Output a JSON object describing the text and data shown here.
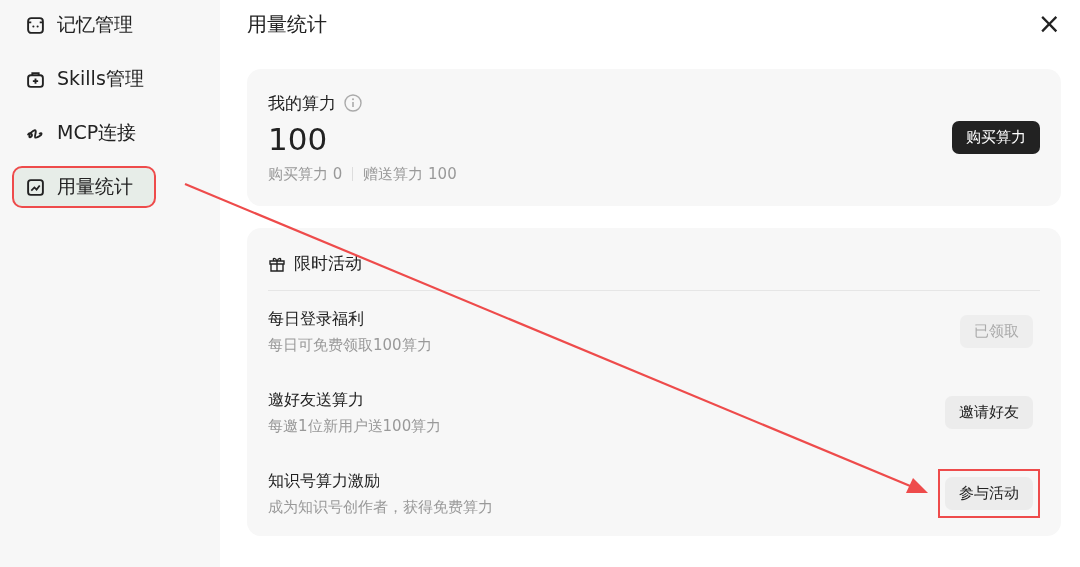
{
  "sidebar": {
    "items": [
      {
        "label": "记忆管理",
        "selected": false,
        "highlighted": false
      },
      {
        "label": "Skills管理",
        "selected": false,
        "highlighted": false
      },
      {
        "label": "MCP连接",
        "selected": false,
        "highlighted": false
      },
      {
        "label": "用量统计",
        "selected": true,
        "highlighted": true
      }
    ]
  },
  "title": "用量统计",
  "close": "×",
  "balance": {
    "label": "我的算力",
    "value": "100",
    "purchased": "购买算力 0",
    "gifted": "赠送算力 100",
    "buy_button": "购买算力"
  },
  "activities": {
    "title": "限时活动",
    "items": [
      {
        "name": "每日登录福利",
        "desc": "每日可免费领取100算力",
        "button": "已领取",
        "disabled": true,
        "highlighted": false
      },
      {
        "name": "邀好友送算力",
        "desc": "每邀1位新用户送100算力",
        "button": "邀请好友",
        "disabled": false,
        "highlighted": false
      },
      {
        "name": "知识号算力激励",
        "desc": "成为知识号创作者，获得免费算力",
        "button": "参与活动",
        "disabled": false,
        "highlighted": true
      }
    ]
  },
  "arrow": true
}
